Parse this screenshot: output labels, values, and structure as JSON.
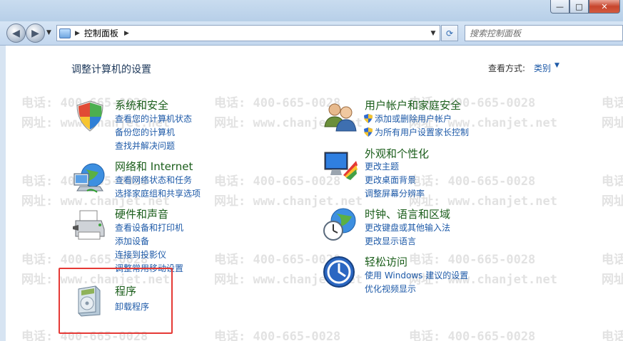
{
  "window": {
    "minimize": "—",
    "maximize": "□",
    "close": "✕"
  },
  "nav": {
    "back": "◀",
    "forward": "▶",
    "address_arrow": "▶",
    "address_text": "控制面板",
    "address_arrow2": "▶",
    "dropdown": "▼",
    "refresh": "⟳",
    "search_placeholder": "搜索控制面板"
  },
  "header": {
    "title": "调整计算机的设置",
    "viewby_label": "查看方式:",
    "viewby_value": "类别",
    "viewby_arrow": "▼"
  },
  "categories": [
    {
      "title": "系统和安全",
      "links": [
        "查看您的计算机状态",
        "备份您的计算机",
        "查找并解决问题"
      ]
    },
    {
      "title": "网络和 Internet",
      "links": [
        "查看网络状态和任务",
        "选择家庭组和共享选项"
      ]
    },
    {
      "title": "硬件和声音",
      "links": [
        "查看设备和打印机",
        "添加设备",
        "连接到投影仪",
        "调整常用移动设置"
      ]
    },
    {
      "title": "程序",
      "links": [
        "卸载程序"
      ]
    },
    {
      "title": "用户帐户和家庭安全",
      "links": [
        "添加或删除用户帐户",
        "为所有用户设置家长控制"
      ]
    },
    {
      "title": "外观和个性化",
      "links": [
        "更改主题",
        "更改桌面背景",
        "调整屏幕分辨率"
      ]
    },
    {
      "title": "时钟、语言和区域",
      "links": [
        "更改键盘或其他输入法",
        "更改显示语言"
      ]
    },
    {
      "title": "轻松访问",
      "links": [
        "使用 Windows 建议的设置",
        "优化视频显示"
      ]
    }
  ],
  "watermark": {
    "phone": "电话: 400-665-0028",
    "site": "网址: www.chanjet.net"
  },
  "colors": {
    "title_green": "#1a5d1a",
    "link_blue": "#1e5aa8",
    "highlight_red": "#e53935"
  }
}
